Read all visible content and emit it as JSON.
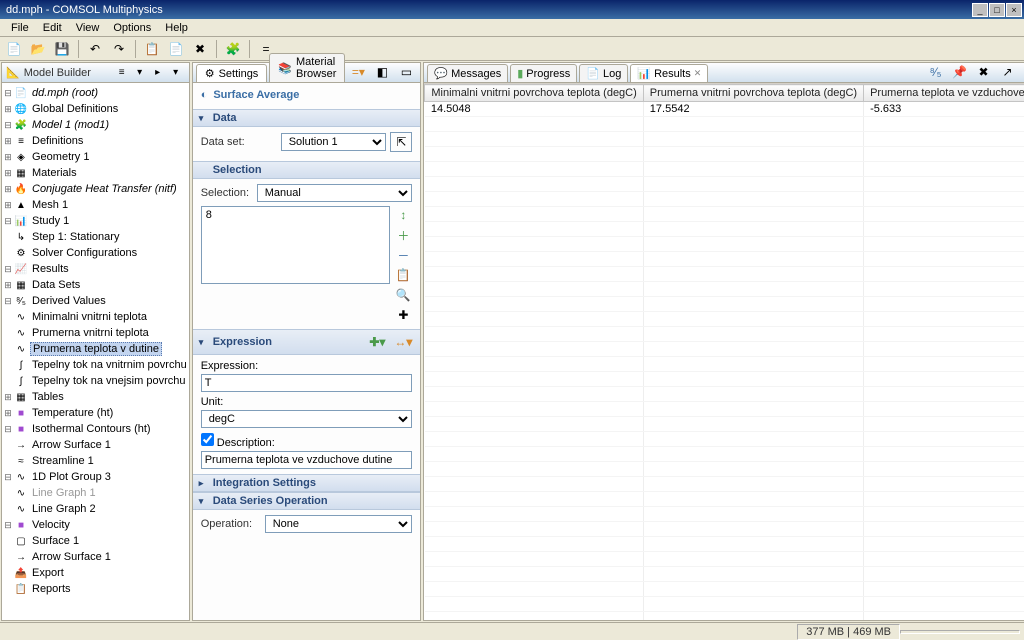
{
  "titlebar": {
    "title": "dd.mph - COMSOL Multiphysics"
  },
  "menu": [
    "File",
    "Edit",
    "View",
    "Options",
    "Help"
  ],
  "model_builder": {
    "title": "Model Builder",
    "tree": [
      {
        "ind": 0,
        "tw": "-",
        "icon": "📄",
        "label": "dd.mph (root)",
        "italic": true
      },
      {
        "ind": 1,
        "tw": "+",
        "icon": "🌐",
        "label": "Global Definitions"
      },
      {
        "ind": 1,
        "tw": "-",
        "icon": "🧩",
        "label": "Model 1 (mod1)",
        "italic": true
      },
      {
        "ind": 2,
        "tw": "+",
        "icon": "≡",
        "label": "Definitions"
      },
      {
        "ind": 2,
        "tw": "+",
        "icon": "◈",
        "label": "Geometry 1"
      },
      {
        "ind": 2,
        "tw": "+",
        "icon": "▦",
        "label": "Materials"
      },
      {
        "ind": 2,
        "tw": "+",
        "icon": "🔥",
        "label": "Conjugate Heat Transfer (nitf)",
        "italic": true
      },
      {
        "ind": 2,
        "tw": "+",
        "icon": "▲",
        "label": "Mesh 1"
      },
      {
        "ind": 1,
        "tw": "-",
        "icon": "📊",
        "label": "Study 1"
      },
      {
        "ind": 2,
        "tw": "",
        "icon": "↳",
        "label": "Step 1: Stationary"
      },
      {
        "ind": 2,
        "tw": "",
        "icon": "⚙",
        "label": "Solver Configurations"
      },
      {
        "ind": 1,
        "tw": "-",
        "icon": "📈",
        "label": "Results"
      },
      {
        "ind": 2,
        "tw": "+",
        "icon": "▦",
        "label": "Data Sets"
      },
      {
        "ind": 2,
        "tw": "-",
        "icon": "⁸⁄₅",
        "label": "Derived Values"
      },
      {
        "ind": 3,
        "tw": "",
        "icon": "∿",
        "label": "Minimalni vnitrni teplota"
      },
      {
        "ind": 3,
        "tw": "",
        "icon": "∿",
        "label": "Prumerna vnitrni teplota"
      },
      {
        "ind": 3,
        "tw": "",
        "icon": "∿",
        "label": "Prumerna teplota v dutine",
        "selected": true
      },
      {
        "ind": 3,
        "tw": "",
        "icon": "∫",
        "label": "Tepelny tok na vnitrnim povrchu"
      },
      {
        "ind": 3,
        "tw": "",
        "icon": "∫",
        "label": "Tepelny tok na vnejsim povrchu"
      },
      {
        "ind": 2,
        "tw": "+",
        "icon": "▦",
        "label": "Tables"
      },
      {
        "ind": 2,
        "tw": "+",
        "icon": "■",
        "label": "Temperature (ht)",
        "col": "#a04ad0"
      },
      {
        "ind": 2,
        "tw": "-",
        "icon": "■",
        "label": "Isothermal Contours (ht)",
        "col": "#a04ad0"
      },
      {
        "ind": 3,
        "tw": "",
        "icon": "→",
        "label": "Arrow Surface 1"
      },
      {
        "ind": 3,
        "tw": "",
        "icon": "≈",
        "label": "Streamline 1"
      },
      {
        "ind": 2,
        "tw": "-",
        "icon": "∿",
        "label": "1D Plot Group 3"
      },
      {
        "ind": 3,
        "tw": "",
        "icon": "∿",
        "label": "Line Graph 1",
        "dim": true
      },
      {
        "ind": 3,
        "tw": "",
        "icon": "∿",
        "label": "Line Graph 2"
      },
      {
        "ind": 2,
        "tw": "-",
        "icon": "■",
        "label": "Velocity",
        "col": "#a04ad0"
      },
      {
        "ind": 3,
        "tw": "",
        "icon": "▢",
        "label": "Surface 1"
      },
      {
        "ind": 3,
        "tw": "",
        "icon": "→",
        "label": "Arrow Surface 1"
      },
      {
        "ind": 2,
        "tw": "",
        "icon": "📤",
        "label": "Export"
      },
      {
        "ind": 2,
        "tw": "",
        "icon": "📋",
        "label": "Reports"
      }
    ]
  },
  "settings": {
    "tabs": {
      "settings": "Settings",
      "matbrowser": "Material Browser"
    },
    "heading": "Surface Average",
    "data": {
      "section": "Data",
      "dataset_label": "Data set:",
      "dataset_value": "Solution 1"
    },
    "selection": {
      "section": "Selection",
      "label": "Selection:",
      "value": "Manual",
      "list_text": "8"
    },
    "expression": {
      "section": "Expression",
      "expr_label": "Expression:",
      "expr_value": "T",
      "unit_label": "Unit:",
      "unit_value": "degC",
      "desc_checked": true,
      "desc_label": "Description:",
      "desc_value": "Prumerna teplota ve vzduchove dutine"
    },
    "integration": {
      "section": "Integration Settings"
    },
    "dso": {
      "section": "Data Series Operation",
      "op_label": "Operation:",
      "op_value": "None"
    }
  },
  "results": {
    "tabs": {
      "messages": "Messages",
      "progress": "Progress",
      "log": "Log",
      "results": "Results"
    },
    "columns": [
      "Minimalni vnitrni povrchova teplota (degC)",
      "Prumerna vnitrni povrchova teplota (degC)",
      "Prumerna teplota ve vzduchove dutine (degC)",
      ""
    ],
    "rows": [
      [
        "14.5048",
        "17.5542",
        "-5.633",
        ""
      ]
    ]
  },
  "statusbar": {
    "mem": "377 MB | 469 MB"
  }
}
